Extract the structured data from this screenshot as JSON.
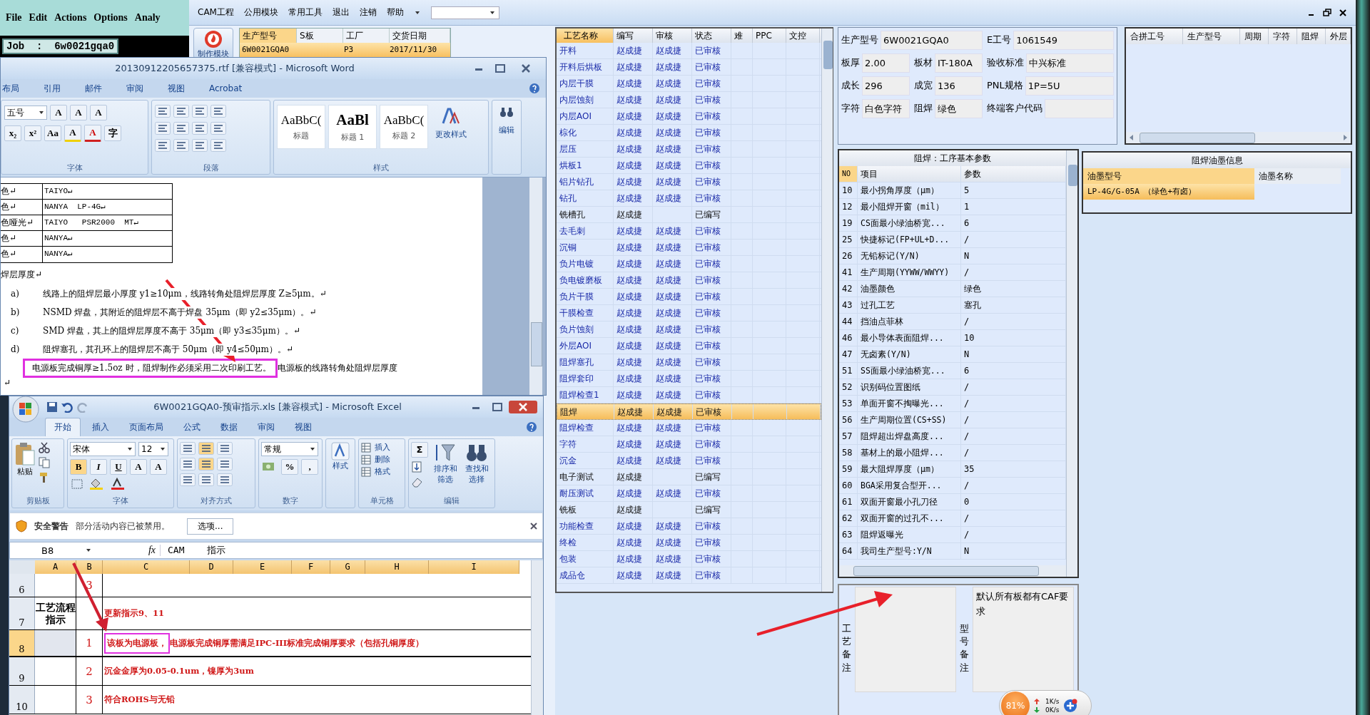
{
  "cam_bar": {
    "menu": [
      "File",
      "Edit",
      "Actions",
      "Options",
      "Analy"
    ],
    "job": "Job  :  6w0021gqa0"
  },
  "main": {
    "menu": [
      "CAM工程",
      "公用模块",
      "常用工具",
      "退出",
      "注销",
      "帮助"
    ],
    "module_button": "制作模块",
    "order_grid": {
      "columns": [
        "生产型号",
        "S板",
        "工厂",
        "交货日期"
      ],
      "rows": [
        {
          "model": "6W0021GQA0",
          "factory": "P3",
          "date": "2017/11/30",
          "selected": true
        }
      ]
    },
    "process_table": {
      "columns": [
        "工艺名称",
        "编写",
        "审核",
        "状态",
        "难",
        "PPC",
        "文控"
      ],
      "rows": [
        {
          "name": "开料",
          "writer": "赵成捷",
          "reviewer": "赵成捷",
          "status": "已审核",
          "reviewed": true,
          "selected": false
        },
        {
          "name": "开料后烘板",
          "writer": "赵成捷",
          "reviewer": "赵成捷",
          "status": "已审核",
          "reviewed": true,
          "selected": false
        },
        {
          "name": "内层干膜",
          "writer": "赵成捷",
          "reviewer": "赵成捷",
          "status": "已审核",
          "reviewed": true,
          "selected": false
        },
        {
          "name": "内层蚀刻",
          "writer": "赵成捷",
          "reviewer": "赵成捷",
          "status": "已审核",
          "reviewed": true,
          "selected": false
        },
        {
          "name": "内层AOI",
          "writer": "赵成捷",
          "reviewer": "赵成捷",
          "status": "已审核",
          "reviewed": true,
          "selected": false
        },
        {
          "name": "棕化",
          "writer": "赵成捷",
          "reviewer": "赵成捷",
          "status": "已审核",
          "reviewed": true,
          "selected": false
        },
        {
          "name": "层压",
          "writer": "赵成捷",
          "reviewer": "赵成捷",
          "status": "已审核",
          "reviewed": true,
          "selected": false
        },
        {
          "name": "烘板1",
          "writer": "赵成捷",
          "reviewer": "赵成捷",
          "status": "已审核",
          "reviewed": true,
          "selected": false
        },
        {
          "name": "铝片钻孔",
          "writer": "赵成捷",
          "reviewer": "赵成捷",
          "status": "已审核",
          "reviewed": true,
          "selected": false
        },
        {
          "name": "钻孔",
          "writer": "赵成捷",
          "reviewer": "赵成捷",
          "status": "已审核",
          "reviewed": true,
          "selected": false
        },
        {
          "name": "铣槽孔",
          "writer": "赵成捷",
          "status": "已编写",
          "reviewed": false,
          "selected": false
        },
        {
          "name": "去毛刺",
          "writer": "赵成捷",
          "reviewer": "赵成捷",
          "status": "已审核",
          "reviewed": true,
          "selected": false
        },
        {
          "name": "沉铜",
          "writer": "赵成捷",
          "reviewer": "赵成捷",
          "status": "已审核",
          "reviewed": true,
          "selected": false
        },
        {
          "name": "负片电镀",
          "writer": "赵成捷",
          "reviewer": "赵成捷",
          "status": "已审核",
          "reviewed": true,
          "selected": false
        },
        {
          "name": "负电镀磨板",
          "writer": "赵成捷",
          "reviewer": "赵成捷",
          "status": "已审核",
          "reviewed": true,
          "selected": false
        },
        {
          "name": "负片干膜",
          "writer": "赵成捷",
          "reviewer": "赵成捷",
          "status": "已审核",
          "reviewed": true,
          "selected": false
        },
        {
          "name": "干膜检查",
          "writer": "赵成捷",
          "reviewer": "赵成捷",
          "status": "已审核",
          "reviewed": true,
          "selected": false
        },
        {
          "name": "负片蚀刻",
          "writer": "赵成捷",
          "reviewer": "赵成捷",
          "status": "已审核",
          "reviewed": true,
          "selected": false
        },
        {
          "name": "外层AOI",
          "writer": "赵成捷",
          "reviewer": "赵成捷",
          "status": "已审核",
          "reviewed": true,
          "selected": false
        },
        {
          "name": "阻焊塞孔",
          "writer": "赵成捷",
          "reviewer": "赵成捷",
          "status": "已审核",
          "reviewed": true,
          "selected": false
        },
        {
          "name": "阻焊套印",
          "writer": "赵成捷",
          "reviewer": "赵成捷",
          "status": "已审核",
          "reviewed": true,
          "selected": false
        },
        {
          "name": "阻焊检查1",
          "writer": "赵成捷",
          "reviewer": "赵成捷",
          "status": "已审核",
          "reviewed": true,
          "selected": false
        },
        {
          "name": "阻焊",
          "writer": "赵成捷",
          "reviewer": "赵成捷",
          "status": "已审核",
          "reviewed": true,
          "selected": true
        },
        {
          "name": "阻焊检查",
          "writer": "赵成捷",
          "reviewer": "赵成捷",
          "status": "已审核",
          "reviewed": true,
          "selected": false
        },
        {
          "name": "字符",
          "writer": "赵成捷",
          "reviewer": "赵成捷",
          "status": "已审核",
          "reviewed": true,
          "selected": false
        },
        {
          "name": "沉金",
          "writer": "赵成捷",
          "reviewer": "赵成捷",
          "status": "已审核",
          "reviewed": true,
          "selected": false
        },
        {
          "name": "电子测试",
          "writer": "赵成捷",
          "status": "已编写",
          "reviewed": false,
          "selected": false
        },
        {
          "name": "耐压测试",
          "writer": "赵成捷",
          "reviewer": "赵成捷",
          "status": "已审核",
          "reviewed": true,
          "selected": false
        },
        {
          "name": "铣板",
          "writer": "赵成捷",
          "status": "已编写",
          "reviewed": false,
          "selected": false
        },
        {
          "name": "功能检查",
          "writer": "赵成捷",
          "reviewer": "赵成捷",
          "status": "已审核",
          "reviewed": true,
          "selected": false
        },
        {
          "name": "终检",
          "writer": "赵成捷",
          "reviewer": "赵成捷",
          "status": "已审核",
          "reviewed": true,
          "selected": false
        },
        {
          "name": "包装",
          "writer": "赵成捷",
          "reviewer": "赵成捷",
          "status": "已审核",
          "reviewed": true,
          "selected": false
        },
        {
          "name": "成品仓",
          "writer": "赵成捷",
          "reviewer": "赵成捷",
          "status": "已审核",
          "reviewed": true,
          "selected": false
        }
      ]
    },
    "info": {
      "fields": [
        {
          "label": "生产型号",
          "value": "6W0021GQA0"
        },
        {
          "label": "E工号",
          "value": "1061549"
        },
        {
          "label": "板厚",
          "value": "2.00"
        },
        {
          "label": "板材",
          "value": "IT-180A"
        },
        {
          "label": "验收标准",
          "value": "中兴标准"
        },
        {
          "label": "成长",
          "value": "296"
        },
        {
          "label": "成宽",
          "value": "136"
        },
        {
          "label": "PNL规格",
          "value": "1P=5U"
        },
        {
          "label": "字符",
          "value": "白色字符"
        },
        {
          "label": "阻焊",
          "value": "绿色"
        },
        {
          "label": "终端客户代码"
        }
      ]
    },
    "merge_grid": {
      "columns": [
        "合拼工号",
        "生产型号",
        "周期",
        "字符",
        "阻焊",
        "外层"
      ]
    },
    "params": {
      "title": "阻焊：工序基本参数",
      "columns": [
        "NO",
        "项目",
        "参数"
      ],
      "rows": [
        {
          "no": "10",
          "item": "最小拐角厚度（μm）",
          "value": "5"
        },
        {
          "no": "12",
          "item": "最小阻焊开窗（mil）",
          "value": "1"
        },
        {
          "no": "19",
          "item": "CS面最小绿油桥宽...",
          "value": "6"
        },
        {
          "no": "25",
          "item": "快捷标记(FP+UL+D...",
          "value": "/"
        },
        {
          "no": "26",
          "item": "无铅标记(Y/N)",
          "value": "N"
        },
        {
          "no": "41",
          "item": "生产周期(YYWW/WWYY)",
          "value": "/"
        },
        {
          "no": "42",
          "item": "油墨颜色",
          "value": "绿色"
        },
        {
          "no": "43",
          "item": "过孔工艺",
          "value": "塞孔"
        },
        {
          "no": "44",
          "item": "挡油点菲林",
          "value": "/"
        },
        {
          "no": "46",
          "item": "最小导体表面阻焊...",
          "value": "10"
        },
        {
          "no": "47",
          "item": "无卤素(Y/N)",
          "value": "N"
        },
        {
          "no": "51",
          "item": "SS面最小绿油桥宽...",
          "value": "6"
        },
        {
          "no": "52",
          "item": "识别码位置图纸",
          "value": "/"
        },
        {
          "no": "53",
          "item": "单面开窗不掏曝光...",
          "value": "/"
        },
        {
          "no": "56",
          "item": "生产周期位置(CS+SS)",
          "value": "/"
        },
        {
          "no": "57",
          "item": "阻焊超出焊盘高度...",
          "value": "/"
        },
        {
          "no": "58",
          "item": "基材上的最小阻焊...",
          "value": "/"
        },
        {
          "no": "59",
          "item": "最大阻焊厚度（μm）",
          "value": "35"
        },
        {
          "no": "60",
          "item": "BGA采用复合型开...",
          "value": "/"
        },
        {
          "no": "61",
          "item": "双面开窗最小孔刀径",
          "value": "0"
        },
        {
          "no": "62",
          "item": "双面开窗的过孔不...",
          "value": "/"
        },
        {
          "no": "63",
          "item": "阻焊返曝光",
          "value": "/"
        },
        {
          "no": "64",
          "item": "我司生产型号:Y/N",
          "value": "N"
        }
      ]
    },
    "ink": {
      "title": "阻焊油墨信息",
      "columns": [
        "油墨型号",
        "油墨名称"
      ],
      "rows": [
        {
          "model": "LP-4G/G-05A （绿色+有卤）",
          "selected": true
        }
      ]
    },
    "notes": {
      "process_label": "工艺备注",
      "model_label": "型号备注",
      "model_note": "默认所有板都有CAF要求"
    }
  },
  "word": {
    "title": "20130912205657375.rtf [兼容模式] - Microsoft Word",
    "tabs": [
      "布局",
      "引用",
      "邮件",
      "审阅",
      "视图",
      "Acrobat"
    ],
    "font_size": "五号",
    "font_buttons": [
      [
        "A",
        "A",
        "A"
      ],
      [
        "x₂",
        "x²",
        "Aa",
        "A",
        "A",
        "字"
      ]
    ],
    "groups": [
      "字体",
      "段落",
      "样式"
    ],
    "styles": [
      {
        "sample": "AaBbC(",
        "name": "标题"
      },
      {
        "sample": "AaBl",
        "name": "标题 1"
      },
      {
        "sample": "AaBbC(",
        "name": "标题 2"
      }
    ],
    "change_styles": "更改样式",
    "edit": "编辑",
    "table": [
      [
        "色↵",
        "TAIYO↵"
      ],
      [
        "色↵",
        "NANYA  LP-4G↵"
      ],
      [
        "色哑光↵",
        "TAIYO   PSR2000  MT↵"
      ],
      [
        "色↵",
        "NANYA↵"
      ],
      [
        "色↵",
        "NANYA↵"
      ]
    ],
    "heading": "焊层厚度↵",
    "items": [
      {
        "mark": "a)",
        "text": "线路上的阻焊层最小厚度 y1≥10μm，线路转角处阻焊层厚度 Z≥5μm。↵"
      },
      {
        "mark": "b)",
        "text": "NSMD 焊盘，其附近的阻焊层不高于焊盘 35μm（即 y2≤35μm）。↵"
      },
      {
        "mark": "c)",
        "text": "SMD 焊盘，其上的阻焊层厚度不高于 35μm（即 y3≤35μm）。↵"
      },
      {
        "mark": "d)",
        "text": "阻焊塞孔，其孔环上的阻焊层不高于 50μm（即 y4≤50μm）。↵"
      }
    ],
    "highlight": "电源板完成铜厚≥1.5oz 时，阻焊制作必须采用二次印刷工艺。",
    "after_highlight": "电源板的线路转角处阻焊层厚度",
    "end_mark": "↵"
  },
  "excel": {
    "title": "6W0021GQA0-预审指示.xls  [兼容模式] - Microsoft Excel",
    "tabs": [
      {
        "label": "开始",
        "selected": true
      },
      {
        "label": "插入",
        "selected": false
      },
      {
        "label": "页面布局",
        "selected": false
      },
      {
        "label": "公式",
        "selected": false
      },
      {
        "label": "数据",
        "selected": false
      },
      {
        "label": "审阅",
        "selected": false
      },
      {
        "label": "视图",
        "selected": false
      }
    ],
    "paste": "粘贴",
    "font": "宋体",
    "size": "12",
    "font_buttons": [
      "B",
      "I",
      "U",
      "A",
      "A"
    ],
    "number_format": "常规",
    "number_buttons": [
      "%",
      ","
    ],
    "styles": "样式",
    "cell_buttons": [
      "插入",
      "删除",
      "格式"
    ],
    "sum": "Σ",
    "sort": "排序和筛选",
    "find": "查找和选择",
    "groups": [
      "剪贴板",
      "字体",
      "对齐方式",
      "数字",
      "单元格",
      "编辑"
    ],
    "security": {
      "title": "安全警告",
      "message": "部分活动内容已被禁用。",
      "button": "选项..."
    },
    "name_box": "B8",
    "fx": "fx",
    "formula": "CAM    指示",
    "columns": [
      "A",
      "B",
      "C",
      "D",
      "E",
      "F",
      "G",
      "H",
      "I"
    ],
    "rows": [
      {
        "num": "6",
        "b": "3",
        "selected": false
      },
      {
        "num": "7",
        "a": "工艺流程指示",
        "c": "更新指示9、11",
        "selected": false
      },
      {
        "num": "8",
        "b": "1",
        "c_highlight": "该板为电源板，",
        "c": "电源板完成铜厚需满足IPC-III标准完成铜厚要求（包括孔铜厚度）",
        "selected": true
      },
      {
        "num": "9",
        "b": "2",
        "c": "沉金金厚为0.05-0.1um，镍厚为3um",
        "selected": false
      },
      {
        "num": "10",
        "b": "3",
        "c": "符合ROHS与无铅",
        "selected": false
      }
    ]
  },
  "net_widget": {
    "percent": "81%",
    "up": "1K/s",
    "down": "0K/s"
  }
}
